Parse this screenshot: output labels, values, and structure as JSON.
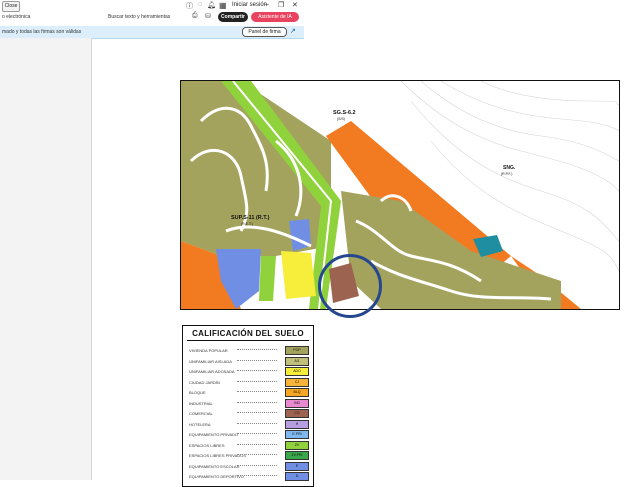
{
  "titlebar": {
    "close_label": "Close",
    "signin_label": "Iniciar sesión"
  },
  "toolbar": {
    "filename": "o electrónica",
    "search_label": "Buscar texto y herramientas",
    "share_label": "Compartir",
    "ai_label": "Asistente de IA"
  },
  "infobar": {
    "message": "mado y todas las firmas son válidas",
    "panel_label": "Panel de firma"
  },
  "map": {
    "labels": {
      "sg": "SG.S-6.2",
      "sg_sub": "(S/S)",
      "sng": "SNG.",
      "sng_sub": "(R.P.F.)",
      "sup": "SUP.S-11 (R.T.)",
      "sup_sub": "(R.E.T.)"
    },
    "colors": {
      "olive": "#a4a35e",
      "orange": "#f27a20",
      "green": "#8fd23b",
      "yellow": "#f6ee3a",
      "blue": "#6f8ee4",
      "brown": "#9c6450",
      "teal": "#1f8ea0",
      "circle": "#24478e"
    }
  },
  "legend": {
    "title": "CALIFICACIÓN DEL SUELO",
    "rows": [
      {
        "label": "Vivienda popular",
        "code": "POP",
        "color": "#a4a35e"
      },
      {
        "label": "Unifamiliar aislada",
        "code": "A/1",
        "color": "#c1c07b"
      },
      {
        "label": "Unifamiliar adosada",
        "code": "ADO",
        "color": "#f6ee3a"
      },
      {
        "label": "Ciudad jardín",
        "code": "CJ",
        "color": "#f6b43a"
      },
      {
        "label": "Bloque",
        "code": "BLQ",
        "color": "#f5a623"
      },
      {
        "label": "Industrial",
        "code": "IND",
        "color": "#e98ad0"
      },
      {
        "label": "Comercial",
        "code": "CO",
        "color": "#9c6450"
      },
      {
        "label": "Hotelera",
        "code": "H",
        "color": "#b79ee0"
      },
      {
        "label": "Equipamiento privado",
        "code": "E.PRI",
        "color": "#7fb7ef"
      },
      {
        "label": "Espacios libres",
        "code": "ZV",
        "color": "#8fd23b"
      },
      {
        "label": "Espacios libres privados",
        "code": "ZV.PRI",
        "color": "#3aa84a"
      },
      {
        "label": "Equipamiento escolar",
        "code": "E",
        "color": "#6f8ee4"
      },
      {
        "label": "Equipamiento deportivo",
        "code": "D",
        "color": "#6f8ee4"
      }
    ]
  }
}
